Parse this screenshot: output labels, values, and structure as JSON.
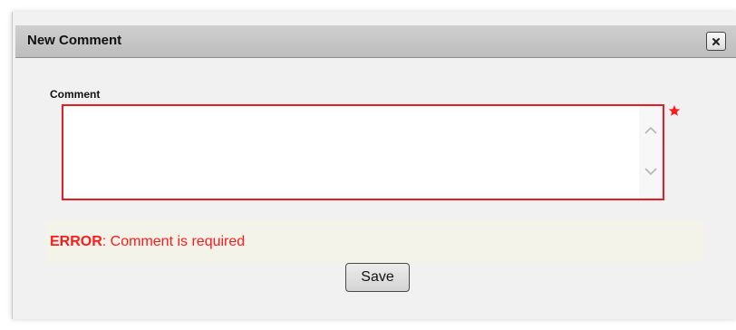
{
  "dialog": {
    "title": "New Comment",
    "close_icon": "close-icon"
  },
  "form": {
    "comment_label": "Comment",
    "comment_value": "",
    "required_icon": "asterisk-icon"
  },
  "error": {
    "prefix": "ERROR",
    "message": ": Comment is required"
  },
  "actions": {
    "save_label": "Save"
  },
  "colors": {
    "error": "#ff1a1a",
    "title_bar": "#c4c4c4",
    "dialog_bg": "#f1f1f1",
    "error_bar_bg": "#f3f3ea"
  }
}
